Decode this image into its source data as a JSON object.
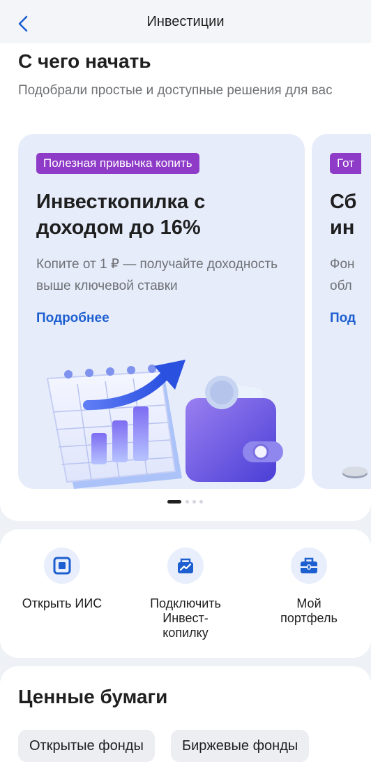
{
  "header": {
    "title": "Инвестиции"
  },
  "intro": {
    "title": "С чего начать",
    "subtitle": "Подобрали простые и доступные решения для вас"
  },
  "promo_cards": [
    {
      "badge": "Полезная привычка копить",
      "title": "Инвесткопилка с доходом до 16%",
      "description": "Копите от 1 ₽ — получайте доходность выше ключевой ставки",
      "link": "Подробнее"
    },
    {
      "badge": "Гот",
      "title_line1": "Сб",
      "title_line2": "ин",
      "desc_line1": "Фон",
      "desc_line2": "обл",
      "link": "Под"
    }
  ],
  "carousel": {
    "total": 4,
    "active": 1
  },
  "actions": [
    {
      "label": "Открыть ИИС",
      "icon": "iis-square-icon"
    },
    {
      "label": "Подключить Инвест-копилку",
      "icon": "piggy-chart-icon"
    },
    {
      "label": "Мой портфель",
      "icon": "briefcase-icon"
    }
  ],
  "securities": {
    "title": "Ценные бумаги",
    "chips": [
      "Открытые фонды",
      "Биржевые фонды"
    ]
  },
  "colors": {
    "accent": "#1d5fd0",
    "badge": "#8e3bc8",
    "card_bg": "#e6ecfa"
  }
}
